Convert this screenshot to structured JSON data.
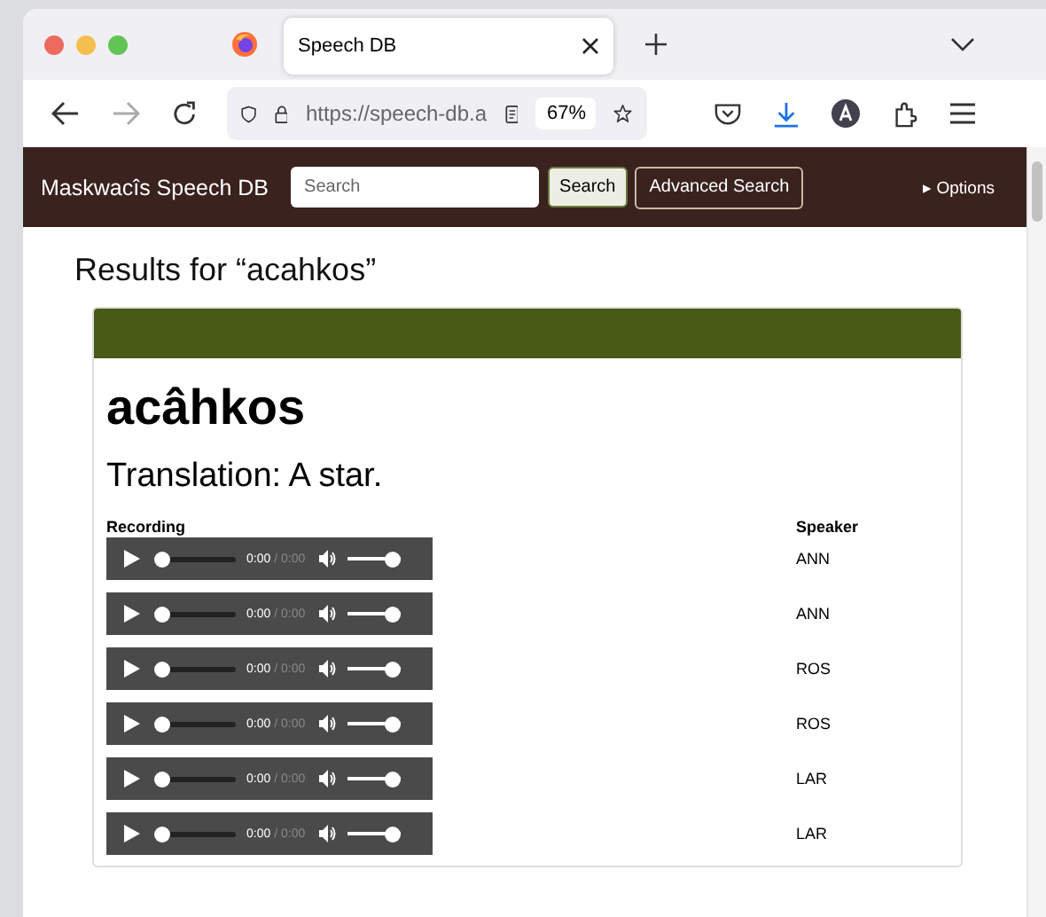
{
  "browser": {
    "tab": {
      "title": "Speech DB",
      "selected": true
    },
    "url": "https://speech-db.a",
    "zoom": "67%"
  },
  "site_nav": {
    "title": "Maskwacîs Speech DB",
    "search": {
      "placeholder": "Search"
    },
    "search_button": "Search",
    "advanced_button": "Advanced Search",
    "options": "▸ Options"
  },
  "results_heading": "Results for “acahkos”",
  "entry": {
    "word": "acâhkos",
    "translation": "Translation: A star.",
    "columns": [
      "Recording",
      "Speaker"
    ],
    "recordings": [
      {
        "time": "0:00",
        "duration": "/ 0:00",
        "level": 0,
        "volume": {
          "level": 1
        },
        "speaker": "ANN"
      },
      {
        "time": "0:00",
        "duration": "/ 0:00",
        "level": 0,
        "volume": {
          "level": 1
        },
        "speaker": "ANN"
      },
      {
        "time": "0:00",
        "duration": "/ 0:00",
        "level": 0,
        "volume": {
          "level": 1
        },
        "speaker": "ROS"
      },
      {
        "time": "0:00",
        "duration": "/ 0:00",
        "level": 0,
        "volume": {
          "level": 1
        },
        "speaker": "ROS"
      },
      {
        "time": "0:00",
        "duration": "/ 0:00",
        "level": 0,
        "volume": {
          "level": 1
        },
        "speaker": "LAR"
      },
      {
        "time": "0:00",
        "duration": "/ 0:00",
        "level": 0,
        "volume": {
          "level": 1
        },
        "speaker": "LAR"
      }
    ]
  }
}
